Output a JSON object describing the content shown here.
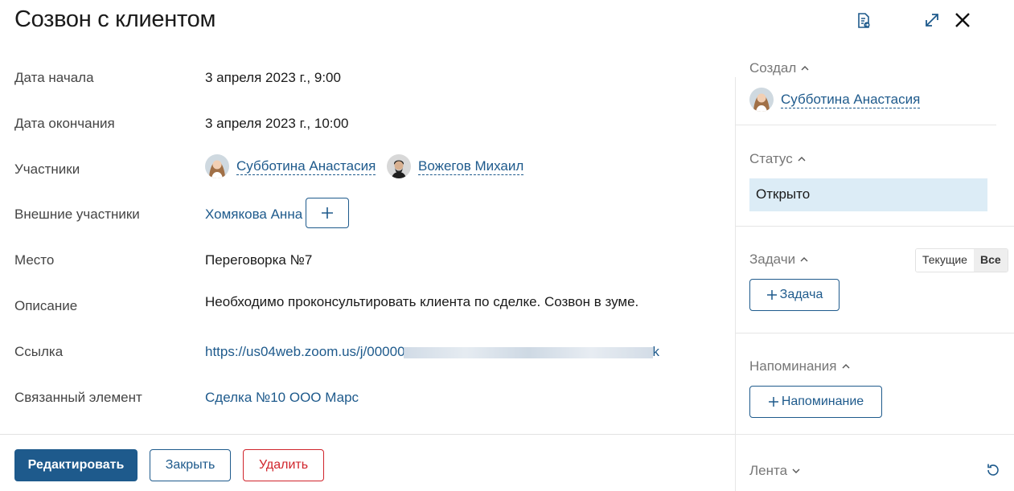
{
  "header": {
    "title": "Созвон с клиентом",
    "icons": [
      "document-export-icon",
      "expand-icon",
      "close-icon"
    ]
  },
  "fields": {
    "start_label": "Дата начала",
    "start_value": "3 апреля 2023 г., 9:00",
    "end_label": "Дата окончания",
    "end_value": "3 апреля 2023 г., 10:00",
    "participants_label": "Участники",
    "participants": [
      "Субботина Анастасия",
      "Вожегов Михаил"
    ],
    "external_label": "Внешние участники",
    "external_value": "Хомякова Анна",
    "place_label": "Место",
    "place_value": "Переговорка №7",
    "description_label": "Описание",
    "description_value": "Необходимо проконсультировать клиента по сделке. Созвон в зуме.",
    "link_label": "Ссылка",
    "link_value": "https://us04web.zoom.us/j/00000",
    "link_tail": "k",
    "related_label": "Связанный элемент",
    "related_value": "Сделка №10 ООО Марс"
  },
  "actions": {
    "edit": "Редактировать",
    "close": "Закрыть",
    "delete": "Удалить"
  },
  "sidebar": {
    "creator_label": "Создал",
    "creator_name": "Субботина Анастасия",
    "status_label": "Статус",
    "status_value": "Открыто",
    "tasks_label": "Задачи",
    "tasks_filter": [
      "Текущие",
      "Все"
    ],
    "tasks_filter_selected": "Все",
    "add_task": "Задача",
    "reminders_label": "Напоминания",
    "add_reminder": "Напоминание",
    "feed_label": "Лента"
  },
  "colors": {
    "accent": "#1e5a8c",
    "danger": "#d0242b",
    "status_bg": "#dcecf6"
  }
}
